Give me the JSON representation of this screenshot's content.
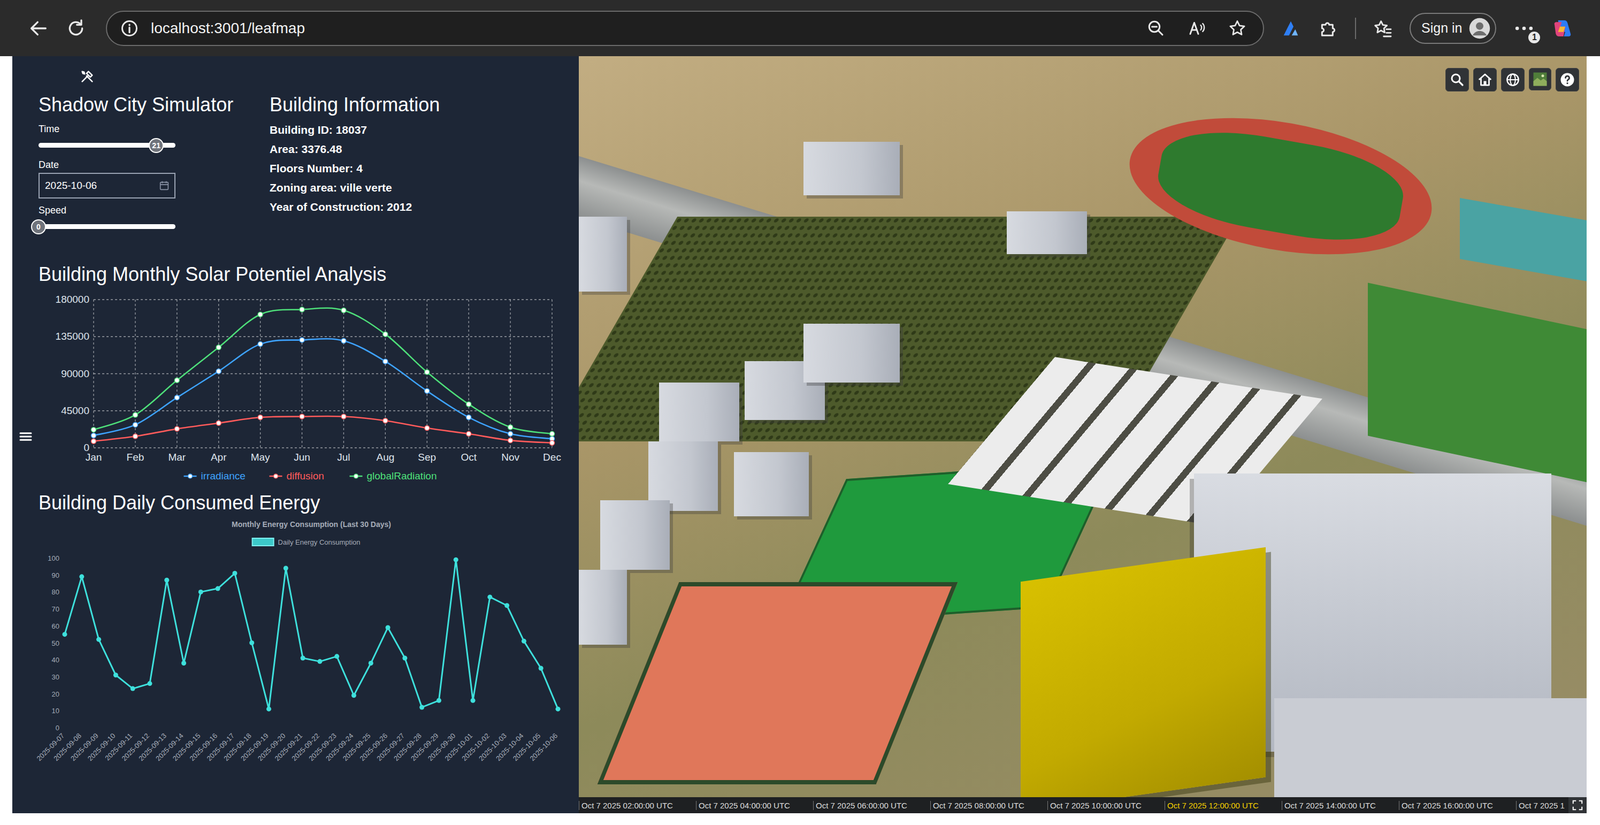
{
  "browser": {
    "url": "localhost:3001/leafmap",
    "sign_in": "Sign in",
    "badge": "1"
  },
  "simulator": {
    "title": "Shadow City Simulator",
    "time": {
      "label": "Time",
      "value": "21",
      "level": 0.86
    },
    "date": {
      "label": "Date",
      "value": "2025-10-06"
    },
    "speed": {
      "label": "Speed",
      "value": "0",
      "level": 0
    }
  },
  "building_info": {
    "title": "Building Information",
    "lines": [
      "Building ID: 18037",
      "Area: 3376.48",
      "Floors Number: 4",
      "Zoning area: ville verte",
      "Year of Construction: 2012"
    ]
  },
  "solar_chart": {
    "title": "Building Monthly Solar Potentiel Analysis",
    "y_ticks": [
      "0",
      "45000",
      "90000",
      "135000",
      "180000"
    ],
    "months": [
      "Jan",
      "Feb",
      "Mar",
      "Apr",
      "May",
      "Jun",
      "Jul",
      "Aug",
      "Sep",
      "Oct",
      "Nov",
      "Dec"
    ],
    "series": [
      {
        "name": "irradiance",
        "color": "#3ea3ff",
        "values": [
          15000,
          28000,
          61000,
          93000,
          126000,
          131000,
          130000,
          105000,
          69000,
          37000,
          17000,
          11000
        ]
      },
      {
        "name": "diffusion",
        "color": "#ff5b5b",
        "values": [
          8000,
          14000,
          23000,
          30000,
          37000,
          38000,
          38000,
          33000,
          24000,
          17000,
          9000,
          6000
        ]
      },
      {
        "name": "globalRadiation",
        "color": "#4ee07a",
        "values": [
          22000,
          40000,
          82000,
          122000,
          162000,
          168000,
          167000,
          138000,
          92000,
          53000,
          25000,
          17000
        ]
      }
    ]
  },
  "energy_chart": {
    "title": "Building Daily Consumed Energy",
    "chart_title": "Monthly Energy Consumption (Last 30 Days)",
    "legend": "Daily Energy Consumption",
    "y_ticks": [
      "0",
      "10",
      "20",
      "30",
      "40",
      "50",
      "60",
      "70",
      "80",
      "90",
      "100"
    ],
    "dates": [
      "2025-09-07",
      "2025-09-08",
      "2025-09-09",
      "2025-09-10",
      "2025-09-11",
      "2025-09-12",
      "2025-09-13",
      "2025-09-14",
      "2025-09-15",
      "2025-09-16",
      "2025-09-17",
      "2025-09-18",
      "2025-09-19",
      "2025-09-20",
      "2025-09-21",
      "2025-09-22",
      "2025-09-23",
      "2025-09-24",
      "2025-09-25",
      "2025-09-26",
      "2025-09-27",
      "2025-09-28",
      "2025-09-29",
      "2025-09-30",
      "2025-10-01",
      "2025-10-02",
      "2025-10-03",
      "2025-10-04",
      "2025-10-05",
      "2025-10-06"
    ],
    "values": [
      55,
      89,
      52,
      31,
      23,
      26,
      87,
      38,
      80,
      82,
      91,
      50,
      11,
      94,
      41,
      39,
      42,
      19,
      38,
      59,
      41,
      12,
      16,
      99,
      16,
      77,
      72,
      51,
      35,
      11
    ]
  },
  "map": {
    "timeline": [
      {
        "label": "Oct 7 2025 02:00:00 UTC",
        "selected": false
      },
      {
        "label": "Oct 7 2025 04:00:00 UTC",
        "selected": false
      },
      {
        "label": "Oct 7 2025 06:00:00 UTC",
        "selected": false
      },
      {
        "label": "Oct 7 2025 08:00:00 UTC",
        "selected": false
      },
      {
        "label": "Oct 7 2025 10:00:00 UTC",
        "selected": false
      },
      {
        "label": "Oct 7 2025 12:00:00 UTC",
        "selected": true
      },
      {
        "label": "Oct 7 2025 14:00:00 UTC",
        "selected": false
      },
      {
        "label": "Oct 7 2025 16:00:00 UTC",
        "selected": false
      },
      {
        "label": "Oct 7 2025 1",
        "selected": false
      }
    ]
  }
}
